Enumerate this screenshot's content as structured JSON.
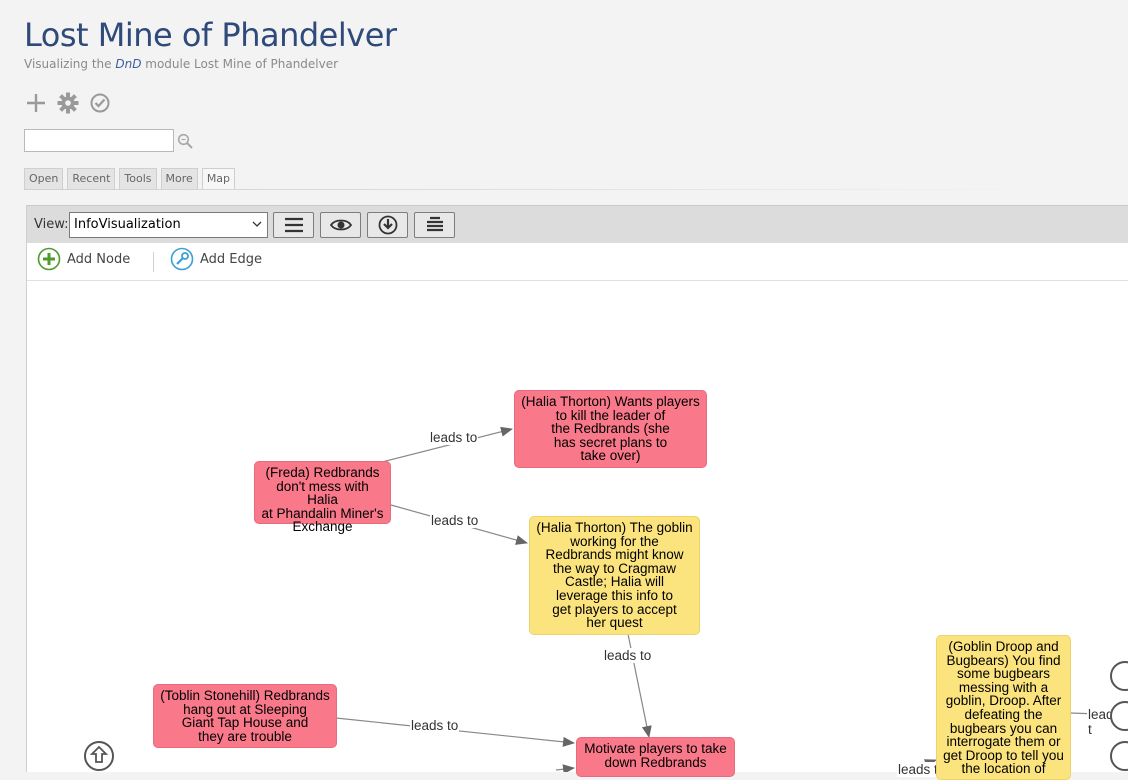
{
  "header": {
    "title": "Lost Mine of Phandelver",
    "subtitle_prefix": "Visualizing the ",
    "subtitle_em": "DnD",
    "subtitle_suffix": " module Lost Mine of Phandelver"
  },
  "toolbar_icons": [
    "plus-icon",
    "gear-icon",
    "check-circle-icon"
  ],
  "search": {
    "value": "",
    "placeholder": ""
  },
  "tabs": [
    {
      "label": "Open"
    },
    {
      "label": "Recent"
    },
    {
      "label": "Tools"
    },
    {
      "label": "More"
    },
    {
      "label": "Map",
      "active": true
    }
  ],
  "map": {
    "view_label": "View:",
    "view_selected": "InfoVisualization",
    "buttons": [
      "menu-icon",
      "eye-icon",
      "download-icon",
      "layers-icon"
    ],
    "add_node_label": "Add Node",
    "add_edge_label": "Add Edge"
  },
  "colors": {
    "pink_node": "#f9788a",
    "yellow_node": "#fbe37e",
    "title": "#2e4a7a"
  },
  "graph": {
    "nodes": [
      {
        "id": "freda",
        "color": "pink",
        "text": "(Freda) Redbrands\ndon't mess with Halia\nat Phandalin Miner's\nExchange"
      },
      {
        "id": "halia1",
        "color": "pink",
        "text": "(Halia Thorton) Wants players\nto kill the leader of\nthe Redbrands (she\nhas secret plans to\ntake over)"
      },
      {
        "id": "halia2",
        "color": "yellow",
        "text": "(Halia Thorton) The goblin\nworking for the\nRedbrands might know\nthe way to Cragmaw\nCastle; Halia will\nleverage this info to\nget players to accept\nher quest"
      },
      {
        "id": "toblin",
        "color": "pink",
        "text": "(Toblin Stonehill) Redbrands\nhang out at Sleeping\nGiant Tap House and\nthey are trouble"
      },
      {
        "id": "motivate",
        "color": "pink",
        "text": "Motivate players  to take\ndown Redbrands"
      },
      {
        "id": "droop",
        "color": "yellow",
        "text": "(Goblin Droop and\nBugbears) You find\nsome bugbears\nmessing with a\ngoblin, Droop. After\ndefeating the\nbugbears you can\ninterrogate them or\nget Droop to tell you\nthe location of"
      }
    ],
    "edges": [
      {
        "from": "freda",
        "to": "halia1",
        "label": "leads to"
      },
      {
        "from": "freda",
        "to": "halia2",
        "label": "leads to"
      },
      {
        "from": "halia2",
        "to": "motivate",
        "label": "leads to"
      },
      {
        "from": "toblin",
        "to": "motivate",
        "label": "leads to"
      },
      {
        "from": "droop",
        "to": "offscreen-right",
        "label": "leads t"
      },
      {
        "from": "offscreen-bottom",
        "to": "droop",
        "label": "leads t"
      }
    ]
  }
}
